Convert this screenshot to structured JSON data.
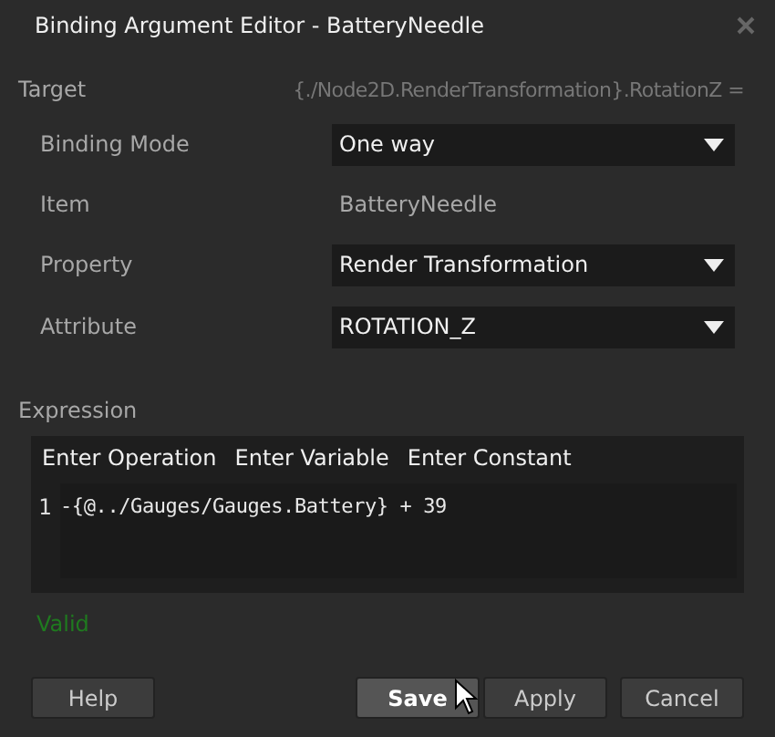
{
  "window": {
    "title": "Binding Argument Editor - BatteryNeedle"
  },
  "target": {
    "label": "Target",
    "value": "{./Node2D.RenderTransformation}.RotationZ ="
  },
  "fields": [
    {
      "kind": "dropdown",
      "label": "Binding Mode",
      "value": "One way"
    },
    {
      "kind": "text",
      "label": "Item",
      "value": "BatteryNeedle"
    },
    {
      "kind": "dropdown",
      "label": "Property",
      "value": "Render Transformation"
    },
    {
      "kind": "dropdown",
      "label": "Attribute",
      "value": "ROTATION_Z"
    }
  ],
  "expression": {
    "label": "Expression",
    "toolbar": [
      "Enter Operation",
      "Enter Variable",
      "Enter Constant"
    ],
    "lines": [
      {
        "number": "1",
        "code": "-{@../Gauges/Gauges.Battery} + 39"
      }
    ]
  },
  "status": "Valid",
  "buttons": [
    {
      "label": "Help",
      "hovered": false
    },
    {
      "label": "Save",
      "hovered": true
    },
    {
      "label": "Apply",
      "hovered": false
    },
    {
      "label": "Cancel",
      "hovered": false
    }
  ]
}
